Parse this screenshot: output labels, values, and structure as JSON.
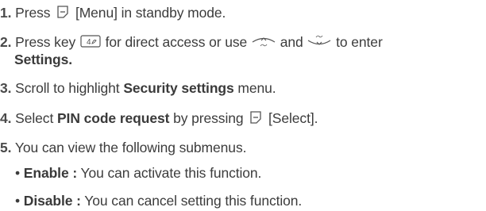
{
  "steps": [
    {
      "number": "1.",
      "parts": {
        "a": "Press",
        "b": "[Menu] in standby mode."
      },
      "icons": [
        "soft-key-left-icon"
      ]
    },
    {
      "number": "2.",
      "parts": {
        "a": "Press key",
        "b": "for direct access or use",
        "c": "and",
        "d": "to enter",
        "e": "Settings."
      },
      "icons": [
        "key-4-icon",
        "nav-up-icon",
        "nav-down-icon"
      ]
    },
    {
      "number": "3.",
      "parts": {
        "a": "Scroll to highlight",
        "b": "Security settings",
        "c": "menu."
      }
    },
    {
      "number": "4.",
      "parts": {
        "a": "Select",
        "b": "PIN code request",
        "c": "by pressing",
        "d": "[Select]."
      },
      "icons": [
        "soft-key-left-icon"
      ]
    },
    {
      "number": "5.",
      "parts": {
        "a": "You can view the following submenus."
      }
    }
  ],
  "submenus": [
    {
      "bullet": "•",
      "label": "Enable :",
      "text": "You can activate this function."
    },
    {
      "bullet": "•",
      "label": "Disable :",
      "text": "You can cancel setting this function."
    }
  ],
  "key_legends": {
    "key4": "4"
  }
}
